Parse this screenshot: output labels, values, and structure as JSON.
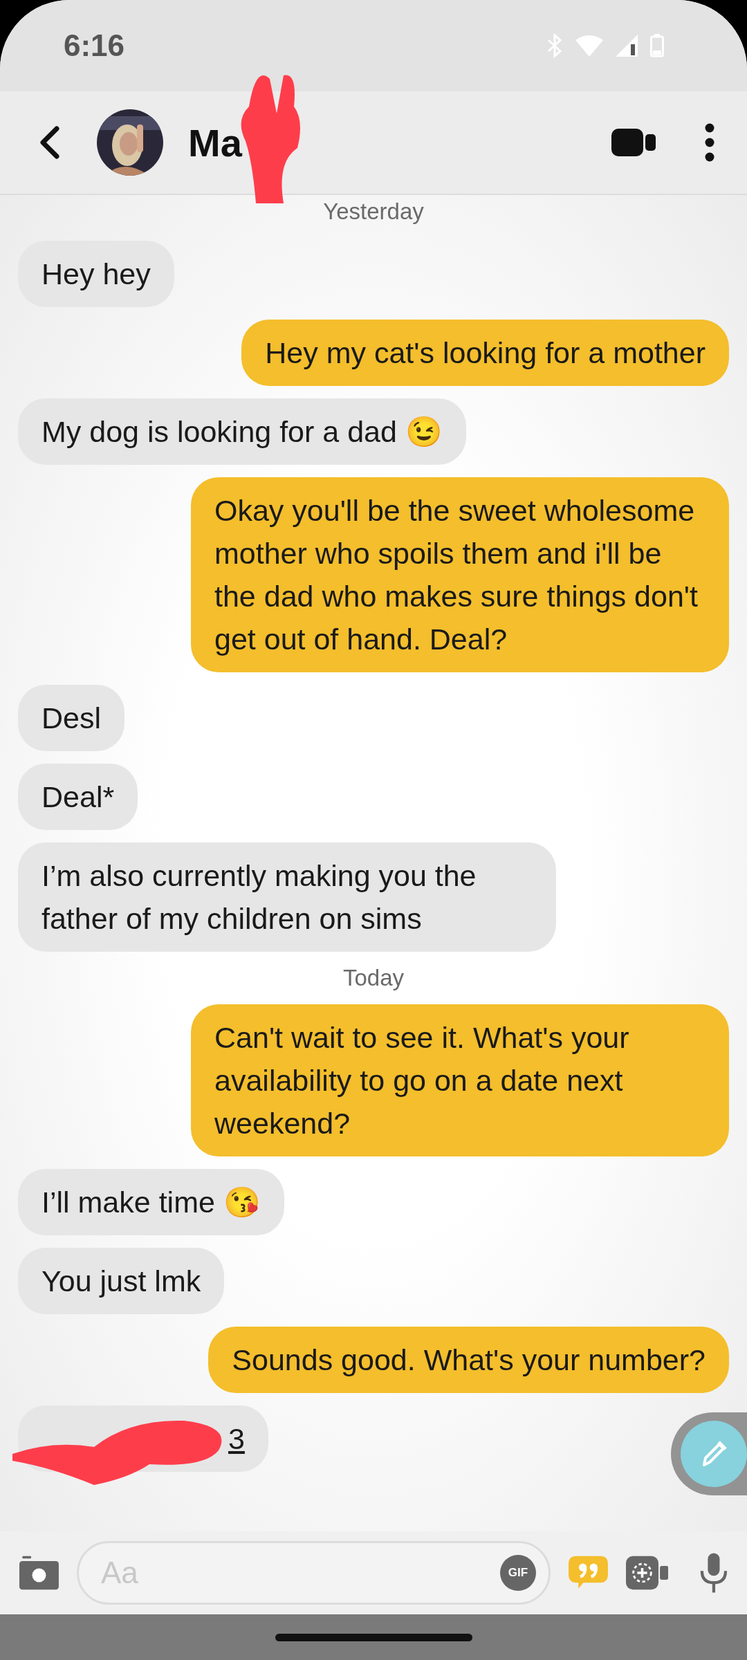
{
  "status_bar": {
    "time": "6:16"
  },
  "header": {
    "name": "Ma"
  },
  "messages": [
    {
      "kind": "date",
      "text": "Yesterday"
    },
    {
      "kind": "received",
      "text": "Hey hey"
    },
    {
      "kind": "sent",
      "text": "Hey my cat's looking for a mother"
    },
    {
      "kind": "received",
      "text": "My dog is looking for a dad 😉"
    },
    {
      "kind": "sent",
      "text": "Okay you'll be the sweet wholesome mother who spoils them and i'll be the dad who makes sure things don't get out of hand. Deal?"
    },
    {
      "kind": "received",
      "text": "Desl"
    },
    {
      "kind": "received",
      "text": "Deal*"
    },
    {
      "kind": "received",
      "text": "I’m also currently making you the father of my children on sims"
    },
    {
      "kind": "date",
      "text": "Today"
    },
    {
      "kind": "sent",
      "text": "Can't wait to see it. What's your availability to go on a date next weekend?"
    },
    {
      "kind": "received",
      "text": "I’ll make time 😘"
    },
    {
      "kind": "received",
      "text": "You just lmk"
    },
    {
      "kind": "sent",
      "text": "Sounds good. What's your number?"
    },
    {
      "kind": "redacted",
      "text": "3"
    }
  ],
  "composer": {
    "placeholder": "Aa",
    "gif": "GIF"
  }
}
